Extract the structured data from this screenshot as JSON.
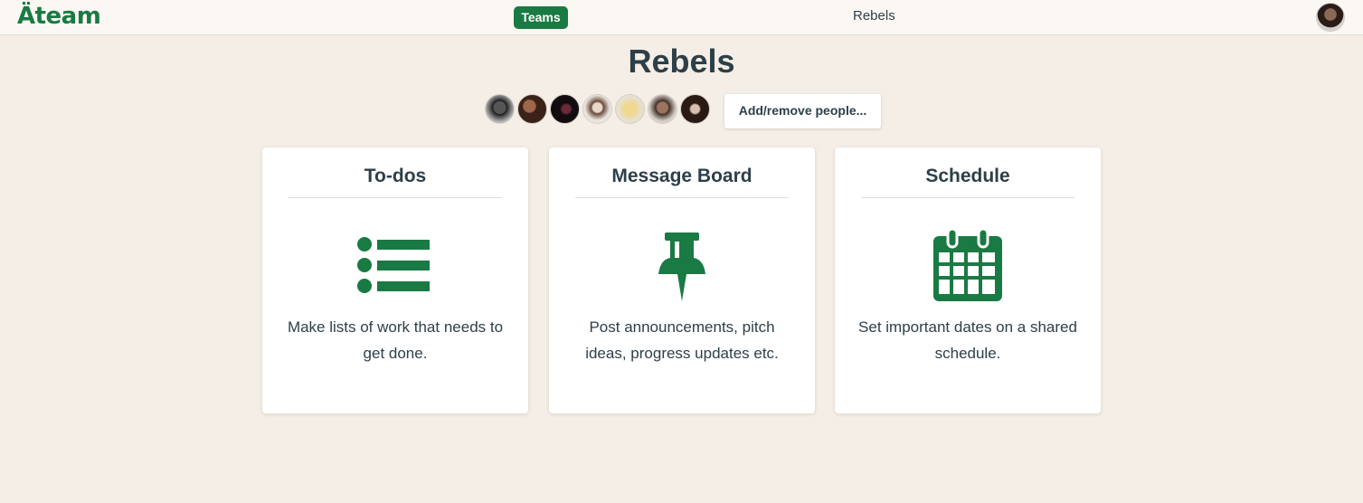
{
  "app": {
    "logo": "Äteam"
  },
  "nav": {
    "teams_label": "Teams",
    "breadcrumb": "Rebels"
  },
  "page": {
    "title": "Rebels"
  },
  "people": {
    "count": 7,
    "add_label": "Add/remove people..."
  },
  "cards": [
    {
      "title": "To-dos",
      "description": "Make lists of work that needs to get done.",
      "icon": "list-icon"
    },
    {
      "title": "Message Board",
      "description": "Post announcements, pitch ideas, progress updates etc.",
      "icon": "pushpin-icon"
    },
    {
      "title": "Schedule",
      "description": "Set important dates on a shared schedule.",
      "icon": "calendar-icon"
    }
  ],
  "colors": {
    "accent": "#1a7a43",
    "background": "#f5eee6",
    "text": "#2d3f48"
  }
}
